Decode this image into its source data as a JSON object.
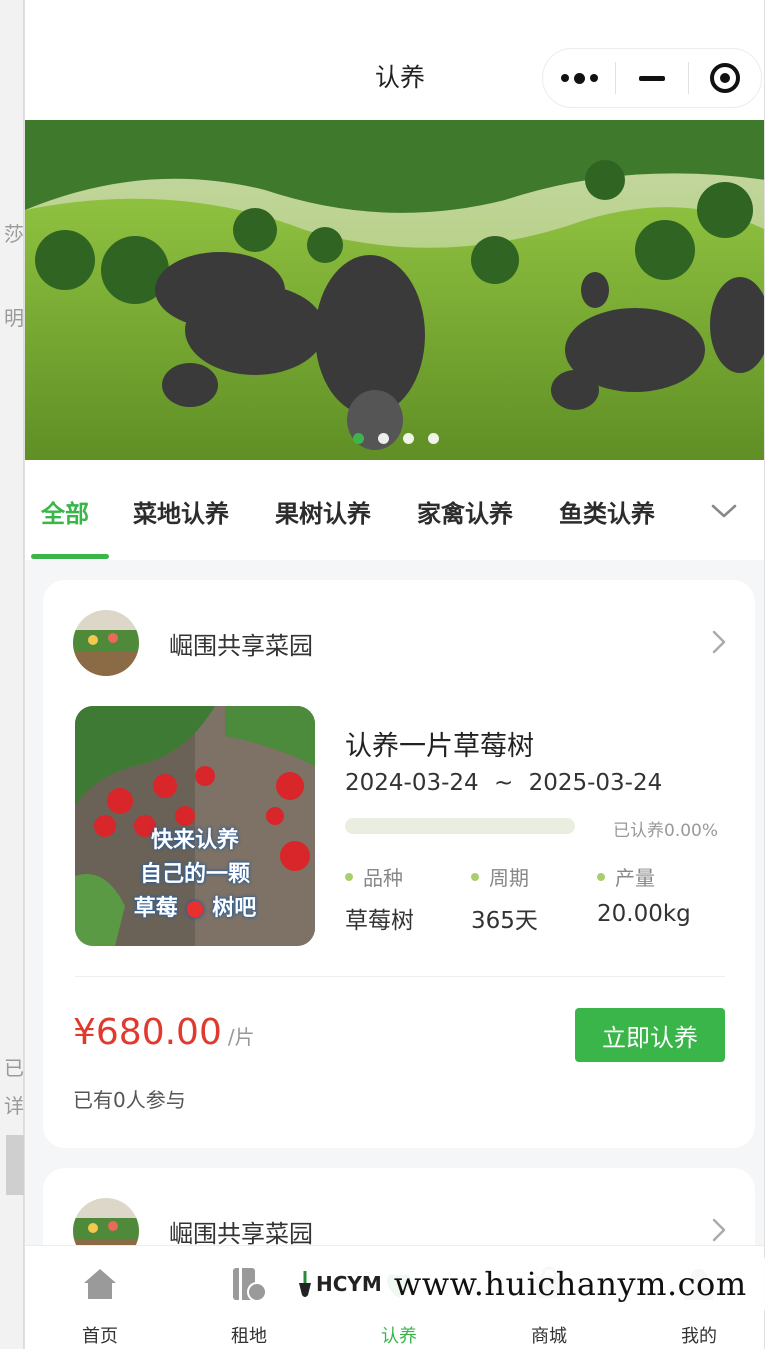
{
  "header": {
    "title": "认养",
    "capsule": [
      "more-icon",
      "minimize-icon",
      "close-target-icon"
    ]
  },
  "banner": {
    "indicators": 4,
    "active_index": 0
  },
  "background_page": {
    "fragments": [
      "莎",
      "明",
      "已",
      "详"
    ]
  },
  "tabs": {
    "items": [
      "全部",
      "菜地认养",
      "果树认养",
      "家禽认养",
      "鱼类认养"
    ],
    "active_index": 0
  },
  "cards": [
    {
      "garden": "崛围共享菜园",
      "product": {
        "title": "认养一片草莓树",
        "start_date": "2024-03-24",
        "range_sep": "~",
        "end_date": "2025-03-24",
        "progress_label": "已认养0.00%",
        "progress": 0.0,
        "image_text": [
          "快来认养",
          "自己的一颗",
          "草莓",
          "树吧"
        ],
        "stats": [
          {
            "label": "品种",
            "value": "草莓树"
          },
          {
            "label": "周期",
            "value": "365天"
          },
          {
            "label": "产量",
            "value": "20.00kg"
          }
        ]
      },
      "price": "¥680.00",
      "price_unit": "/片",
      "button_label": "立即认养",
      "participants": "已有0人参与"
    },
    {
      "garden": "崛围共享菜园"
    }
  ],
  "tabbar": {
    "items": [
      {
        "label": "首页",
        "icon": "home-icon"
      },
      {
        "label": "租地",
        "icon": "land-icon"
      },
      {
        "label": "认养",
        "icon": "adopt-icon"
      },
      {
        "label": "商城",
        "icon": "shop-icon"
      },
      {
        "label": "我的",
        "icon": "profile-icon"
      }
    ],
    "active_index": 2
  },
  "watermark": {
    "logo": "HCYM",
    "url": "www.huichanym.com"
  },
  "colors": {
    "accent": "#39b54a",
    "price": "#e03a2f",
    "page_bg": "#f5f6f7"
  }
}
